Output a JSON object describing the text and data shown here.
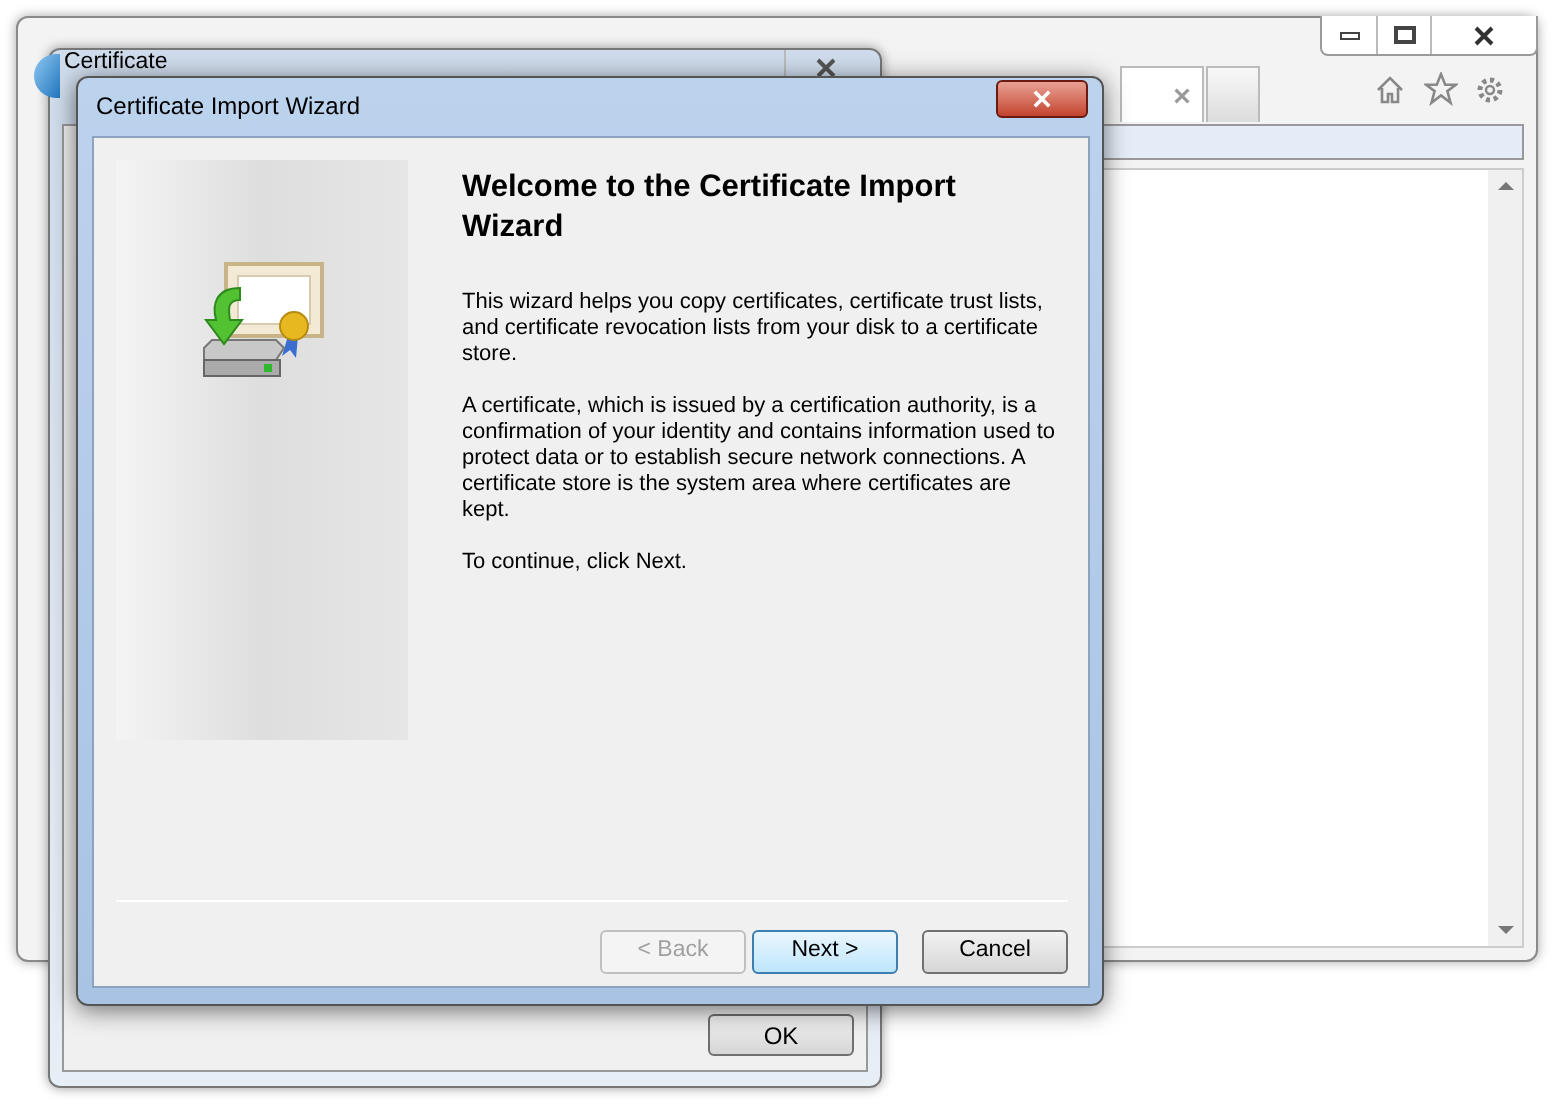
{
  "certificate_dialog": {
    "title": "Certificate",
    "ok_button": "OK"
  },
  "wizard": {
    "title": "Certificate Import Wizard",
    "heading": "Welcome to the Certificate Import Wizard",
    "paragraphs": [
      "This wizard helps you copy certificates, certificate trust lists, and certificate revocation lists from your disk to a certificate store.",
      "A certificate, which is issued by a certification authority, is a confirmation of your identity and contains information used to protect data or to establish secure network connections. A certificate store is the system area where certificates are kept.",
      "To continue, click Next."
    ],
    "buttons": [
      {
        "label": "< Back",
        "disabled": true,
        "default": false
      },
      {
        "label": "Next >",
        "disabled": false,
        "default": true
      },
      {
        "label": "Cancel",
        "disabled": false,
        "default": false
      }
    ]
  }
}
